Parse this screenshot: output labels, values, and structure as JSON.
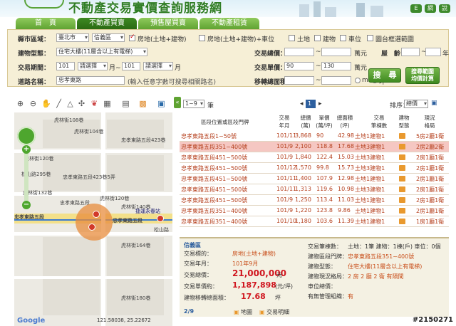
{
  "site": {
    "title": "不動產交易實價查詢服務網",
    "lang_buttons": [
      "E",
      "網",
      "說"
    ]
  },
  "nav": {
    "tabs": [
      "首　頁",
      "不動產買賣",
      "預售屋買賣",
      "不動產租賃"
    ],
    "active": 1
  },
  "search": {
    "city_label": "縣市區域：",
    "city_value": "臺北市",
    "district_value": "信義區",
    "type_checks": [
      {
        "label": "房地(土地+建物)",
        "checked": true
      },
      {
        "label": "房地(土地+建物)+車位",
        "checked": false
      },
      {
        "label": "土地",
        "checked": false
      },
      {
        "label": "建物",
        "checked": false
      },
      {
        "label": "車位",
        "checked": false
      },
      {
        "label": "圖台框選範圍",
        "checked": false
      }
    ],
    "building_label": "建物型態：",
    "building_value": "住宅大樓(11層含以上有電梯)",
    "total_label": "交易總價：",
    "total_unit": "萬元",
    "floor_label": "屋　齡：",
    "floor_unit": "年",
    "period_label": "交易期間：",
    "period_from_year": "101",
    "period_from_month": "請選擇",
    "month_unit": "月~",
    "period_to_year": "101",
    "period_to_month": "請選擇",
    "month_unit_end": "月",
    "unit_price_label": "交易單價：",
    "unit_price_from": "90",
    "unit_price_to": "130",
    "unit_price_unit": "萬元",
    "road_label": "道路名稱：",
    "road_value": "忠孝東路",
    "road_hint": "(輸入任意字數可搜尋相關路名)",
    "area_label": "移轉總面積：",
    "area_unit_m2": "m2",
    "area_unit_ping": "坪",
    "search_button": "搜　尋",
    "range_button_l1": "搜尋範圍",
    "range_button_l2": "均價計算"
  },
  "map": {
    "streets": [
      "虎林街108巷",
      "虎林街104巷",
      "忠孝東路五段423巷",
      "虎林街120巷",
      "松山路295巷",
      "忠孝東路五段423巷5弄",
      "虎林街132巷",
      "虎林街120巷",
      "忠孝東路五段",
      "虎林街140巷",
      "松山路",
      "捷運永春站",
      "忠孝東路五段",
      "虎林街164巷",
      "虎林街180巷",
      "忠孝東路五段"
    ],
    "coords": "121.58038, 25.22672",
    "brand": "Google"
  },
  "list": {
    "page_range": "1~9",
    "page_unit": "筆",
    "page_current": "1",
    "sort_label": "排序：",
    "sort_value": "總價",
    "headers": [
      "區段位置或區段門牌",
      "交易\n年月",
      "總價\n(萬)",
      "單價\n(萬/坪)",
      "總面積\n(坪)",
      "交易\n筆棟數",
      "建物\n型態",
      "現況\n格局"
    ],
    "rows": [
      {
        "addr": "忠孝東路五段1~50號",
        "ym": "101/11",
        "total": "3,868",
        "unit": "90",
        "area": "42.98",
        "cnt": "土地1建物1",
        "layout": "5房2廳1衛"
      },
      {
        "addr": "忠孝東路五段351~400號",
        "ym": "101/9",
        "total": "2,100",
        "unit": "118.8",
        "area": "17.68",
        "cnt": "土地3建物1",
        "layout": "2房2廳2衛"
      },
      {
        "addr": "忠孝東路五段451~500號",
        "ym": "101/9",
        "total": "1,840",
        "unit": "122.4",
        "area": "15.03",
        "cnt": "土地3建物1",
        "layout": "2房1廳1衛"
      },
      {
        "addr": "忠孝東路五段451~500號",
        "ym": "101/12",
        "total": "1,570",
        "unit": "99.8",
        "area": "15.73",
        "cnt": "土地3建物1",
        "layout": "2房1廳1衛"
      },
      {
        "addr": "忠孝東路五段451~500號",
        "ym": "101/11",
        "total": "1,400",
        "unit": "107.9",
        "area": "12.98",
        "cnt": "土地1建物1",
        "layout": "2房1廳1衛"
      },
      {
        "addr": "忠孝東路五段451~500號",
        "ym": "101/11",
        "total": "1,313",
        "unit": "119.6",
        "area": "10.98",
        "cnt": "土地3建物1",
        "layout": "2房1廳1衛"
      },
      {
        "addr": "忠孝東路五段451~500號",
        "ym": "101/9",
        "total": "1,250",
        "unit": "113.4",
        "area": "11.03",
        "cnt": "土地1建物1",
        "layout": "2房1廳1衛"
      },
      {
        "addr": "忠孝東路五段351~400號",
        "ym": "101/9",
        "total": "1,220",
        "unit": "123.8",
        "area": "9.86",
        "cnt": "土地1建物1",
        "layout": "2房1廳1衛"
      },
      {
        "addr": "忠孝東路五段351~400號",
        "ym": "101/10",
        "total": "1,180",
        "unit": "103.6",
        "area": "11.39",
        "cnt": "土地1建物1",
        "layout": "1房1廳1衛"
      }
    ]
  },
  "detail": {
    "district": "信義區",
    "type_label": "交易標的：",
    "type_value": "房地(土地+建物)",
    "ym_label": "交易年月：",
    "ym_value": "101年9月",
    "total_label": "交易總價：",
    "total_value": "21,000,000",
    "total_unit": "元",
    "unit_label": "交易單價約：",
    "unit_value": "1,187,898",
    "unit_unit": "(元/坪)",
    "area_label": "建物移轉總面積：",
    "area_value": "17.68",
    "area_unit": "坪",
    "cnt_label": "交易筆棟數：",
    "cnt_value": "土地：1筆 建物：1棟(戶) 車位：0個",
    "addr_label": "建物區段門牌：",
    "addr_value": "忠孝東路五段351~400號",
    "btype_label": "建物型態：",
    "btype_value": "住宅大樓(11層含以上有電梯)",
    "layout_label": "建物現況格局：",
    "layout_value": "2 房 2 廳 2 衛 有隔間",
    "parking_label": "車位總價：",
    "mgmt_label": "有無管理組織：",
    "mgmt_value": "有",
    "page": "2/9",
    "map_link": "地圖",
    "detail_link": "交易明細"
  },
  "watermark": "#2150271"
}
